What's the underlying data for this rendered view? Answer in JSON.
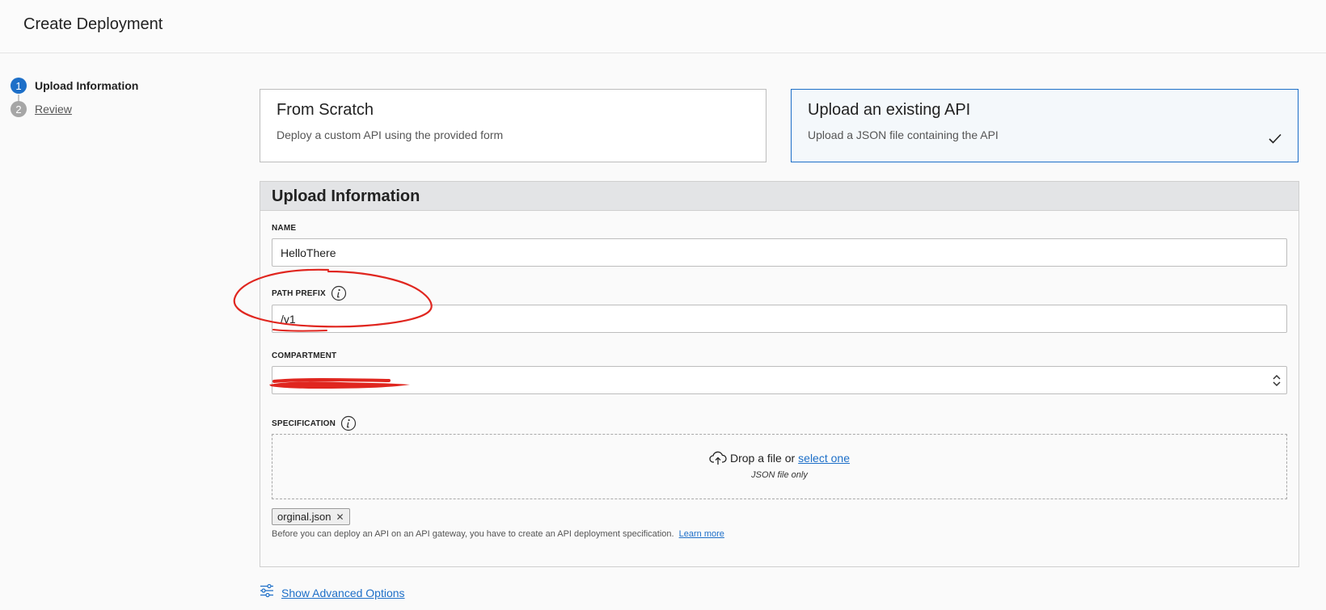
{
  "header": {
    "title": "Create Deployment"
  },
  "steps": [
    {
      "number": "1",
      "label": "Upload Information",
      "state": "active"
    },
    {
      "number": "2",
      "label": "Review",
      "state": "inactive"
    }
  ],
  "cards": {
    "scratch": {
      "title": "From Scratch",
      "description": "Deploy a custom API using the provided form"
    },
    "upload": {
      "title": "Upload an existing API",
      "description": "Upload a JSON file containing the API",
      "selected": true
    }
  },
  "form": {
    "title": "Upload Information",
    "name": {
      "label": "NAME",
      "value": "HelloThere"
    },
    "path_prefix": {
      "label": "PATH PREFIX",
      "value": "/v1"
    },
    "compartment": {
      "label": "COMPARTMENT",
      "value": ""
    },
    "specification": {
      "label": "SPECIFICATION",
      "drop_text": "Drop a file or",
      "select_link": "select one",
      "hint": "JSON file only"
    },
    "uploaded_file": "orginal.json",
    "helper_text": "Before you can deploy an API on an API gateway, you have to create an API deployment specification.",
    "learn_more": "Learn more"
  },
  "advanced": {
    "label": "Show Advanced Options"
  },
  "colors": {
    "accent": "#1d6fc8",
    "annotation": "#e0261f",
    "card_selected_bg": "#f4f8fb"
  },
  "icons": [
    "info-icon",
    "upload-cloud-icon",
    "checkmark-icon",
    "chevron-updown-icon",
    "close-icon",
    "sliders-icon"
  ]
}
